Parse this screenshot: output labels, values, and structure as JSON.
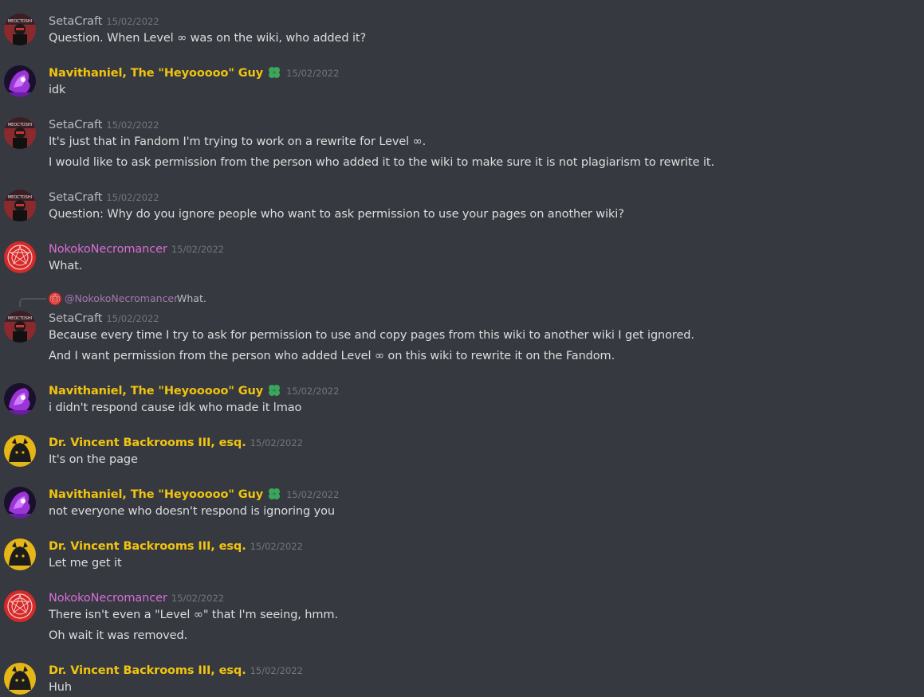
{
  "users": {
    "seta": {
      "name": "SetaCraft",
      "color": "#b9bbbe"
    },
    "navi": {
      "name": "Navithaniel, The \"Heyooooo\" Guy",
      "color": "#f1c40f"
    },
    "noko": {
      "name": "NokokoNecromancer",
      "color": "#d96dd6"
    },
    "vince": {
      "name": "Dr. Vincent Backrooms III, esq.",
      "color": "#f1c40f"
    }
  },
  "badge_icon": "four-leaf-clover-icon",
  "messages": [
    {
      "user": "seta",
      "time": "15/02/2022",
      "lines": [
        "Question. When Level ∞ was on the wiki, who added it?"
      ]
    },
    {
      "user": "navi",
      "time": "15/02/2022",
      "badge": true,
      "lines": [
        "idk"
      ]
    },
    {
      "user": "seta",
      "time": "15/02/2022",
      "lines": [
        "It's just that in Fandom I'm trying to work on a rewrite for Level ∞.",
        "I would like to ask permission from the person who added it to the wiki to make sure it is not plagiarism to rewrite it."
      ]
    },
    {
      "user": "seta",
      "time": "15/02/2022",
      "lines": [
        "Question: Why do you ignore people who want to ask permission to use your pages on another wiki?"
      ]
    },
    {
      "user": "noko",
      "time": "15/02/2022",
      "lines": [
        "What."
      ]
    },
    {
      "user": "seta",
      "time": "15/02/2022",
      "reply": {
        "name": "@NokokoNecromancer",
        "text": "What."
      },
      "lines": [
        "Because every time I try to ask for permission to use and copy pages from this wiki to another wiki I get ignored.",
        "And I want permission from the person who added Level ∞ on this wiki to rewrite it on the Fandom."
      ]
    },
    {
      "user": "navi",
      "time": "15/02/2022",
      "badge": true,
      "lines": [
        "i didn't respond cause idk who made it lmao"
      ]
    },
    {
      "user": "vince",
      "time": "15/02/2022",
      "lines": [
        "It's on the page"
      ]
    },
    {
      "user": "navi",
      "time": "15/02/2022",
      "badge": true,
      "lines": [
        "not everyone who doesn't respond is ignoring you"
      ]
    },
    {
      "user": "vince",
      "time": "15/02/2022",
      "lines": [
        "Let me get it"
      ]
    },
    {
      "user": "noko",
      "time": "15/02/2022",
      "lines": [
        "There isn't even a \"Level ∞\" that I'm seeing, hmm.",
        "Oh wait it was removed."
      ]
    },
    {
      "user": "vince",
      "time": "15/02/2022",
      "lines": [
        "Huh"
      ]
    }
  ]
}
